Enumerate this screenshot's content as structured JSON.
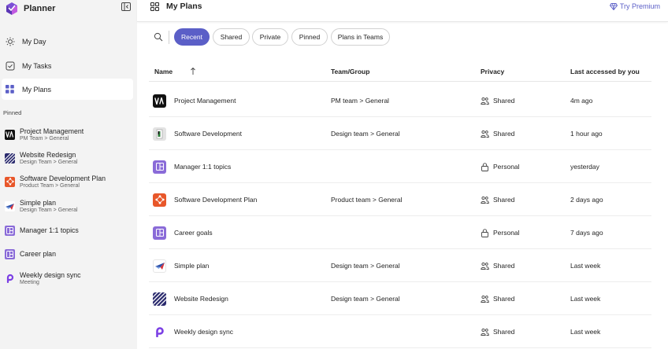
{
  "app": {
    "name": "Planner"
  },
  "nav": [
    {
      "label": "My Day",
      "icon": "sun-icon"
    },
    {
      "label": "My Tasks",
      "icon": "tasks-icon"
    },
    {
      "label": "My Plans",
      "icon": "grid-icon",
      "active": true
    }
  ],
  "pinned": {
    "label": "Pinned",
    "items": [
      {
        "title": "Project Management",
        "subtitle": "PM Team > General",
        "icon": "pm-logo-icon"
      },
      {
        "title": "Website Redesign",
        "subtitle": "Design Team > General",
        "icon": "stripes-icon"
      },
      {
        "title": "Software Development Plan",
        "subtitle": "Product Team > General",
        "icon": "network-icon"
      },
      {
        "title": "Simple plan",
        "subtitle": "Design Team > General",
        "icon": "plane-icon"
      },
      {
        "title": "Manager 1:1 topics",
        "subtitle": "",
        "icon": "board-icon"
      },
      {
        "title": "Career plan",
        "subtitle": "",
        "icon": "board-icon"
      },
      {
        "title": "Weekly design sync",
        "subtitle": "Meeting",
        "icon": "loop-icon"
      }
    ]
  },
  "header": {
    "title": "My Plans",
    "premium": "Try Premium"
  },
  "filters": [
    "Recent",
    "Shared",
    "Private",
    "Pinned",
    "Plans in Teams"
  ],
  "table": {
    "columns": [
      "Name",
      "Team/Group",
      "Privacy",
      "Last accessed by you"
    ],
    "rows": [
      {
        "name": "Project Management",
        "team": "PM team > General",
        "privacy": "Shared",
        "accessed": "4m ago"
      },
      {
        "name": "Software Development",
        "team": "Design team > General",
        "privacy": "Shared",
        "accessed": "1 hour ago"
      },
      {
        "name": "Manager 1:1 topics",
        "team": "",
        "privacy": "Personal",
        "accessed": "yesterday"
      },
      {
        "name": "Software Development Plan",
        "team": "Product team > General",
        "privacy": "Shared",
        "accessed": "2 days ago"
      },
      {
        "name": "Career goals",
        "team": "",
        "privacy": "Personal",
        "accessed": "7 days ago"
      },
      {
        "name": "Simple plan",
        "team": "Design team > General",
        "privacy": "Shared",
        "accessed": "Last week"
      },
      {
        "name": "Website Redesign",
        "team": "Design team > General",
        "privacy": "Shared",
        "accessed": "Last week"
      },
      {
        "name": "Weekly design sync",
        "team": "",
        "privacy": "Shared",
        "accessed": "Last week"
      }
    ]
  },
  "colors": {
    "accent": "#5b5fc7",
    "sidebar": "#f3f3f3",
    "purple_icon": "#8a6bd8",
    "orange_icon": "#e8572a"
  }
}
